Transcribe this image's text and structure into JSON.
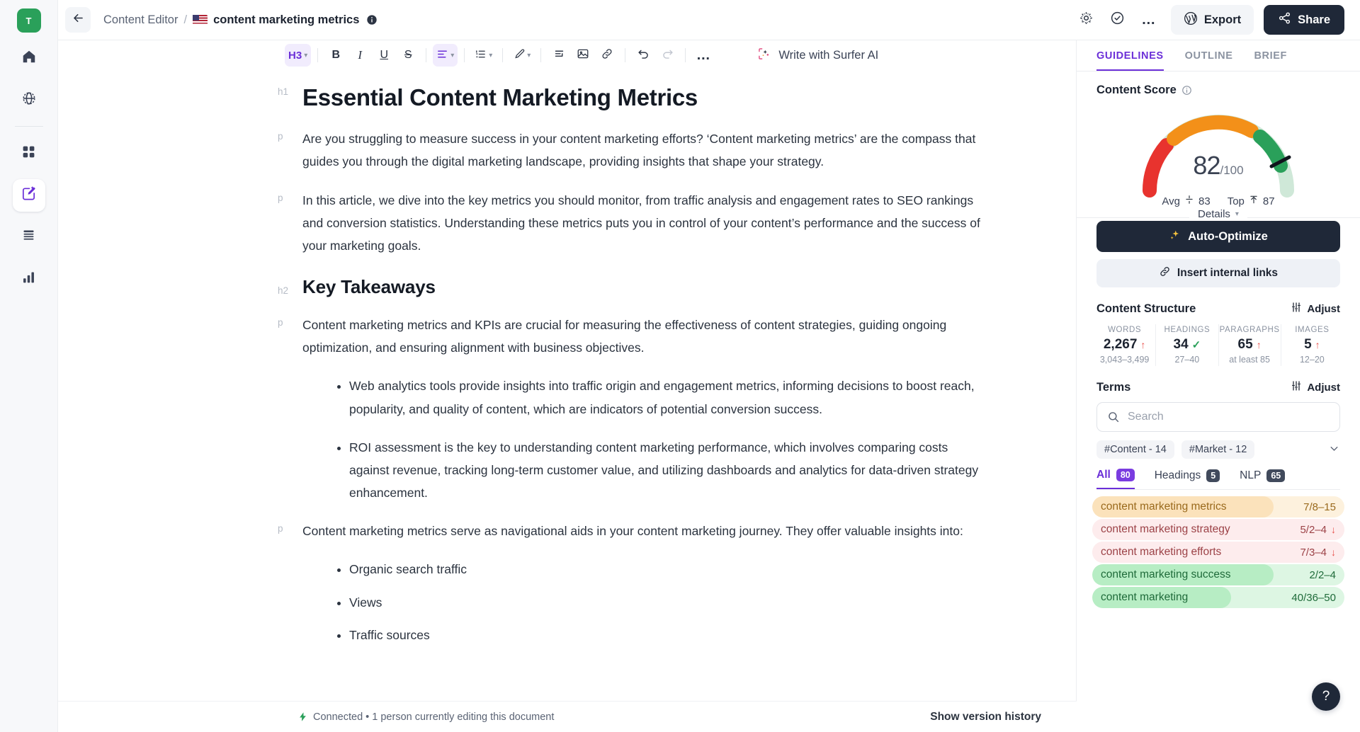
{
  "app": {
    "avatar_initial": "T",
    "breadcrumb": {
      "parent": "Content Editor",
      "separator": "/",
      "current": "content marketing metrics"
    },
    "header_buttons": {
      "export": "Export",
      "share": "Share"
    }
  },
  "left_rail": {
    "items": [
      {
        "name": "home",
        "icon": "home-icon"
      },
      {
        "name": "globe",
        "icon": "globe-icon"
      },
      {
        "name": "apps",
        "icon": "grid-icon"
      },
      {
        "name": "content-editor",
        "icon": "content-editor-icon",
        "active": true
      },
      {
        "name": "outline",
        "icon": "lines-icon"
      },
      {
        "name": "analytics",
        "icon": "bar-chart-icon"
      }
    ]
  },
  "toolbar": {
    "heading_level": "H3",
    "bold": "B",
    "italic": "I",
    "underline": "U",
    "strikethrough": "S",
    "surfer_ai": "Write with Surfer AI",
    "more": "…"
  },
  "document": {
    "title": "Essential Content Marketing Metrics",
    "blocks": [
      {
        "tag": "h1",
        "type": "h1",
        "text": "Essential Content Marketing Metrics"
      },
      {
        "tag": "p",
        "type": "p",
        "text": "Are you struggling to measure success in your content marketing efforts? ‘Content marketing metrics’ are the compass that guides you through the digital marketing landscape, providing insights that shape your strategy."
      },
      {
        "tag": "p",
        "type": "p",
        "text": "In this article, we dive into the key metrics you should monitor, from traffic analysis and engagement rates to SEO rankings and conversion statistics. Understanding these metrics puts you in control of your content’s performance and the success of your marketing goals."
      },
      {
        "tag": "h2",
        "type": "h2",
        "text": "Key Takeaways"
      },
      {
        "tag": "p",
        "type": "p",
        "text": "Content marketing metrics and KPIs are crucial for measuring the effectiveness of content strategies, guiding ongoing optimization, and ensuring alignment with business objectives."
      }
    ],
    "takeaway_bullets": [
      "Web analytics tools provide insights into traffic origin and engagement metrics, informing decisions to boost reach, popularity, and quality of content, which are indicators of potential conversion success.",
      "ROI assessment is the key to understanding content marketing performance, which involves comparing costs against revenue, tracking long-term customer value, and utilizing dashboards and analytics for data-driven strategy enhancement."
    ],
    "closing_paragraph": "Content marketing metrics serve as navigational aids in your content marketing journey. They offer valuable insights into:",
    "insight_bullets": [
      "Organic search traffic",
      "Views",
      "Traffic sources"
    ]
  },
  "status_bar": {
    "connection": "Connected • 1 person currently editing this document",
    "version_history": "Show version history"
  },
  "panel": {
    "tabs": [
      {
        "label": "GUIDELINES",
        "active": true
      },
      {
        "label": "OUTLINE",
        "active": false
      },
      {
        "label": "BRIEF",
        "active": false
      }
    ],
    "content_score": {
      "title": "Content Score",
      "score": "82",
      "denominator": "/100",
      "avg_label": "Avg",
      "avg_value": "83",
      "top_label": "Top",
      "top_value": "87",
      "details_label": "Details",
      "colors": {
        "red": "#e8332e",
        "orange": "#f39019",
        "green": "#2aa05a",
        "track": "#cfe8d8"
      }
    },
    "actions": {
      "auto_optimize": "Auto-Optimize",
      "insert_internal_links": "Insert internal links"
    },
    "content_structure": {
      "title": "Content Structure",
      "adjust": "Adjust",
      "stats": [
        {
          "label": "WORDS",
          "value": "2,267",
          "indicator": "up",
          "range": "3,043–3,499"
        },
        {
          "label": "HEADINGS",
          "value": "34",
          "indicator": "check",
          "range": "27–40"
        },
        {
          "label": "PARAGRAPHS",
          "value": "65",
          "indicator": "up",
          "range": "at least 85"
        },
        {
          "label": "IMAGES",
          "value": "5",
          "indicator": "up",
          "range": "12–20"
        }
      ]
    },
    "terms": {
      "title": "Terms",
      "adjust": "Adjust",
      "search_placeholder": "Search",
      "search_value": "",
      "tags": [
        "#Content - 14",
        "#Market - 12"
      ],
      "tabs": [
        {
          "label": "All",
          "count": "80",
          "active": true
        },
        {
          "label": "Headings",
          "count": "5",
          "active": false
        },
        {
          "label": "NLP",
          "count": "65",
          "active": false
        }
      ],
      "rows": [
        {
          "name": "content marketing metrics",
          "usage": "7/8–15",
          "indicator": "",
          "fill": 0.72,
          "fill_color": "#fbe2bb",
          "bg": "#fdf1dd",
          "text_color": "#9a6a1d"
        },
        {
          "name": "content marketing strategy",
          "usage": "5/2–4",
          "indicator": "down",
          "fill": 1.0,
          "fill_color": "#fdeced",
          "bg": "#fdeced",
          "text_color": "#9c4247"
        },
        {
          "name": "content marketing efforts",
          "usage": "7/3–4",
          "indicator": "down",
          "fill": 1.0,
          "fill_color": "#fdeced",
          "bg": "#fdeced",
          "text_color": "#9c4247"
        },
        {
          "name": "content marketing success",
          "usage": "2/2–4",
          "indicator": "",
          "fill": 0.72,
          "fill_color": "#b7edc4",
          "bg": "#ddf6e3",
          "text_color": "#1f6b3a"
        },
        {
          "name": "content marketing",
          "usage": "40/36–50",
          "indicator": "",
          "fill": 0.55,
          "fill_color": "#b7edc4",
          "bg": "#ddf6e3",
          "text_color": "#1f6b3a"
        }
      ]
    },
    "help_label": "?"
  }
}
